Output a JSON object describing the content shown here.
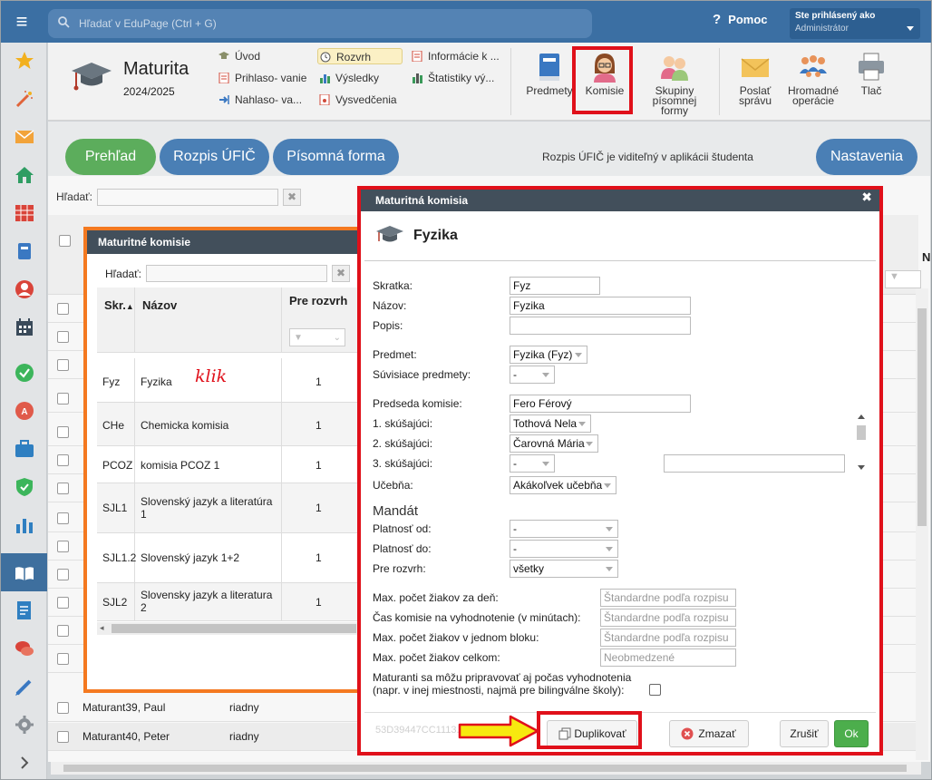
{
  "topbar": {
    "search_placeholder": "Hľadať v EduPage (Ctrl + G)",
    "help": "Pomoc",
    "user_line1": "Ste prihlásený ako",
    "user_line2": "Administrátor"
  },
  "module": {
    "title": "Maturita",
    "year": "2024/2025",
    "nav": [
      {
        "label": "Úvod"
      },
      {
        "label": "Prihlaso- vanie"
      },
      {
        "label": "Nahlaso- va..."
      },
      {
        "label": "Rozvrh"
      },
      {
        "label": "Výsledky"
      },
      {
        "label": "Vysvedčenia"
      },
      {
        "label": "Informácie k ..."
      },
      {
        "label": "Štatistiky vý..."
      }
    ],
    "buttons": [
      {
        "label": "Predmety"
      },
      {
        "label": "Komisie"
      },
      {
        "label": "Skupiny písomnej formy"
      },
      {
        "label": "Poslať správu"
      },
      {
        "label": "Hromadné operácie"
      },
      {
        "label": "Tlač"
      }
    ]
  },
  "tabs": {
    "items": [
      "Prehľad",
      "Rozpis ÚFIČ",
      "Písomná forma"
    ],
    "info": "Rozpis ÚFIČ je viditeľný v aplikácii študenta",
    "settings": "Nastavenia",
    "colors": {
      "active": "#5cad5c",
      "inactive": "#4a7fb5"
    }
  },
  "background": {
    "search_label": "Hľadať:",
    "col_n": "N",
    "rows": [
      {
        "name": "Maturant39, Paul",
        "type": "riadny"
      },
      {
        "name": "Maturant40, Peter",
        "type": "riadny"
      }
    ]
  },
  "panel": {
    "title": "Maturitné komisie",
    "search_label": "Hľadať:",
    "headers": {
      "skr": "Skr.",
      "nazov": "Názov",
      "pre": "Pre rozvrh"
    },
    "rows": [
      {
        "skr": "Fyz",
        "nazov": "Fyzika",
        "pre": "1"
      },
      {
        "skr": "CHe",
        "nazov": "Chemicka komisia",
        "pre": "1"
      },
      {
        "skr": "PCOZ",
        "nazov": "komisia PCOZ 1",
        "pre": "1"
      },
      {
        "skr": "SJL1",
        "nazov": "Slovenský jazyk a literatúra 1",
        "pre": "1"
      },
      {
        "skr": "SJL1.2",
        "nazov": "Slovenský jazyk 1+2",
        "pre": "1"
      },
      {
        "skr": "SJL2",
        "nazov": "Slovensky jazyk a literatura 2",
        "pre": "1"
      }
    ],
    "annotation": "klik"
  },
  "dialog": {
    "title": "Maturitná komisia",
    "heading": "Fyzika",
    "fields": {
      "skratka": {
        "label": "Skratka:",
        "value": "Fyz"
      },
      "nazov": {
        "label": "Názov:",
        "value": "Fyzika"
      },
      "popis": {
        "label": "Popis:",
        "value": ""
      },
      "predmet": {
        "label": "Predmet:",
        "value": "Fyzika (Fyz)"
      },
      "suvisiace": {
        "label": "Súvisiace predmety:",
        "value": "-"
      },
      "predseda": {
        "label": "Predseda komisie:",
        "value": "Fero Férový"
      },
      "s1": {
        "label": "1. skúšajúci:",
        "value": "Tothová Nela"
      },
      "s2": {
        "label": "2. skúšajúci:",
        "value": "Čarovná Mária"
      },
      "s3": {
        "label": "3. skúšajúci:",
        "value": "-"
      },
      "ucebna": {
        "label": "Učebňa:",
        "value": "Akákoľvek učebňa"
      },
      "mandat": "Mandát",
      "platnost_od": {
        "label": "Platnosť od:",
        "value": "-"
      },
      "platnost_do": {
        "label": "Platnosť do:",
        "value": "-"
      },
      "pre_rozvrh": {
        "label": "Pre rozvrh:",
        "value": "všetky"
      },
      "max_den": {
        "label": "Max. počet žiakov za deň:",
        "placeholder": "Štandardne podľa rozpisu"
      },
      "cas": {
        "label": "Čas komisie na vyhodnotenie (v minútach):",
        "placeholder": "Štandardne podľa rozpisu"
      },
      "max_blok": {
        "label": "Max. počet žiakov v jednom bloku:",
        "placeholder": "Štandardne podľa rozpisu"
      },
      "max_celkom": {
        "label": "Max. počet žiakov celkom:",
        "placeholder": "Neobmedzené"
      },
      "pripravovat_1": "Maturanti sa môžu pripravovať aj počas vyhodnotenia",
      "pripravovat_2": "(napr. v inej miestnosti, najmä pre bilingválne školy):"
    },
    "id": "53D39447CC1113...",
    "buttons": {
      "duplicate": "Duplikovať",
      "delete": "Zmazať",
      "cancel": "Zrušiť",
      "ok": "Ok"
    }
  }
}
